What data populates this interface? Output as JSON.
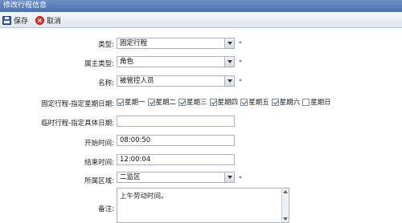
{
  "window": {
    "title": "修改行程信息"
  },
  "toolbar": {
    "save_label": "保存",
    "cancel_label": "取消"
  },
  "form": {
    "type_label": "类型:",
    "type_value": "固定行程",
    "owner_type_label": "属主类型:",
    "owner_type_value": "角色",
    "name_label": "名称:",
    "name_value": "被管控人员",
    "fixed_days_label": "固定行程-指定星期日期:",
    "days": [
      {
        "label": "星期一",
        "checked": true
      },
      {
        "label": "星期二",
        "checked": true
      },
      {
        "label": "星期三",
        "checked": true
      },
      {
        "label": "星期四",
        "checked": true
      },
      {
        "label": "星期五",
        "checked": true
      },
      {
        "label": "星期六",
        "checked": true
      },
      {
        "label": "星期日",
        "checked": false
      }
    ],
    "temp_date_label": "临时行程-指定具体日期:",
    "temp_date_value": "",
    "start_time_label": "开始时间:",
    "start_time_value": "08:00:50",
    "end_time_label": "结束时间:",
    "end_time_value": "12:00:04",
    "area_label": "所属区域:",
    "area_value": "二监区",
    "remark_label": "备注:",
    "remark_value": "上午劳动时间。",
    "required_mark": "*"
  }
}
